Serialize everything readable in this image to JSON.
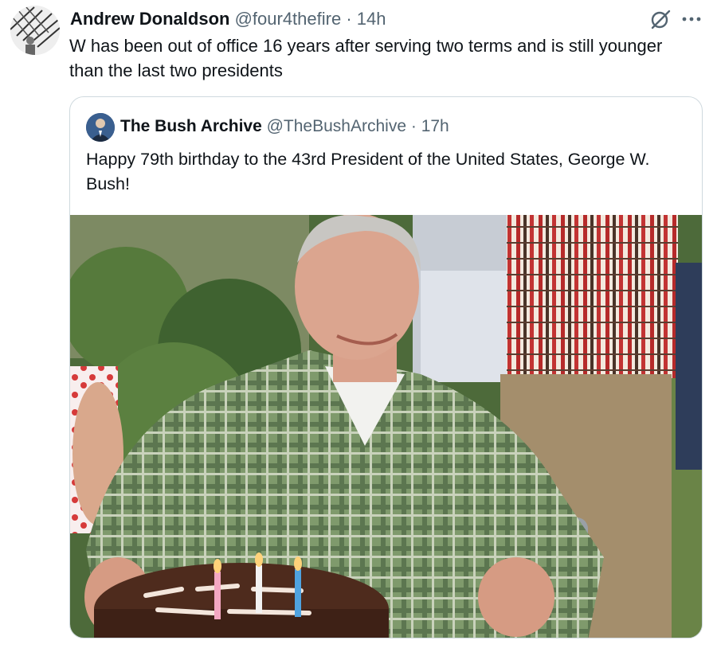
{
  "tweet": {
    "author_name": "Andrew Donaldson",
    "handle": "@four4thefire",
    "separator": "·",
    "time": "14h",
    "text": "W has been out of office 16 years after serving two terms and is still younger than the last two presidents",
    "icons": [
      "profile-avatar",
      "grok-icon",
      "more-icon"
    ]
  },
  "quoted_tweet": {
    "author_name": "The Bush Archive",
    "handle": "@TheBushArchive",
    "separator": "·",
    "time": "17h",
    "text": "Happy 79th birthday to the 43rd President of the United States, George W. Bush!",
    "photo_alt": "photo"
  },
  "colors": {
    "text_primary": "#0f1419",
    "text_secondary": "#536471",
    "border": "#cfd9de"
  }
}
